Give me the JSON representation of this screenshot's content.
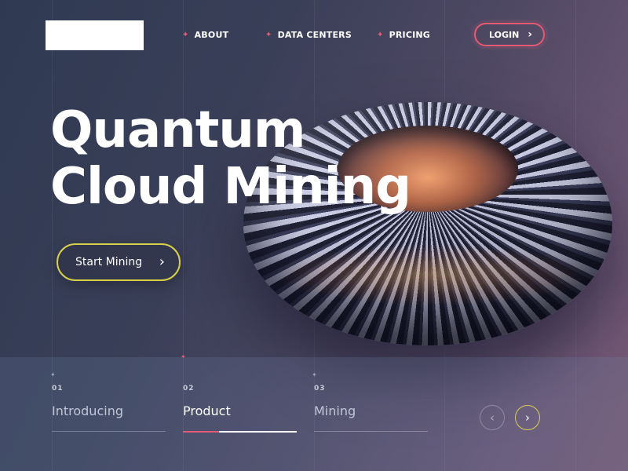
{
  "nav": {
    "items": [
      {
        "label": "ABOUT"
      },
      {
        "label": "DATA CENTERS"
      },
      {
        "label": "PRICING"
      }
    ],
    "login_label": "LOGIN"
  },
  "hero": {
    "title_line1": "Quantum",
    "title_line2": "Cloud Mining",
    "cta_label": "Start Mining"
  },
  "steps": [
    {
      "num": "01",
      "label": "Introducing",
      "active": false
    },
    {
      "num": "02",
      "label": "Product",
      "active": true,
      "progress": 0.32
    },
    {
      "num": "03",
      "label": "Mining",
      "active": false
    }
  ],
  "icons": {
    "nav_bullet": "bullet-icon",
    "login_arrow": "chevron-right-icon",
    "cta_arrow": "chevron-right-icon",
    "prev": "chevron-left-icon",
    "next": "chevron-right-icon"
  },
  "colors": {
    "accent_pink": "#e35a72",
    "accent_yellow": "#d9d04a"
  }
}
